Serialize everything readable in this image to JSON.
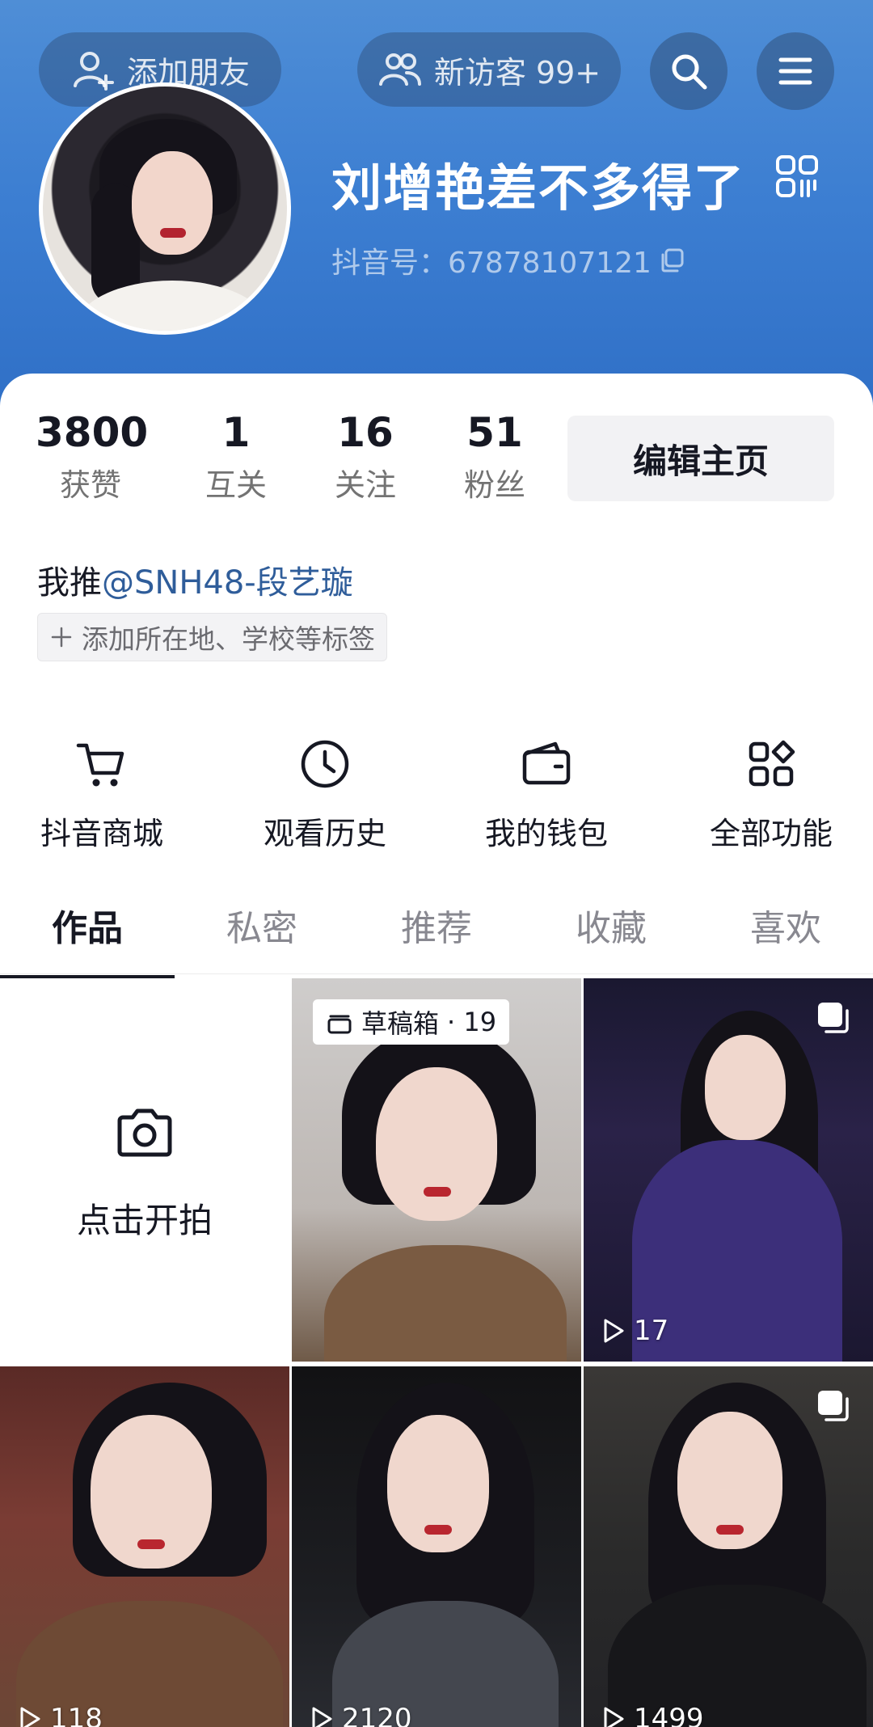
{
  "header": {
    "add_friend": "添加朋友",
    "visitors": "新访客 99+",
    "nickname": "刘增艳差不多得了",
    "douyin_id": "抖音号：67878107121"
  },
  "stats": [
    {
      "value": "3800",
      "label": "获赞"
    },
    {
      "value": "1",
      "label": "互关"
    },
    {
      "value": "16",
      "label": "关注"
    },
    {
      "value": "51",
      "label": "粉丝"
    }
  ],
  "edit_profile": "编辑主页",
  "bio": {
    "prefix": "我推",
    "mention": "@SNH48-段艺璇"
  },
  "add_tag": "添加所在地、学校等标签",
  "quick_actions": [
    {
      "label": "抖音商城",
      "icon": "cart-icon"
    },
    {
      "label": "观看历史",
      "icon": "clock-icon"
    },
    {
      "label": "我的钱包",
      "icon": "wallet-icon"
    },
    {
      "label": "全部功能",
      "icon": "grid-icon"
    }
  ],
  "tabs": [
    "作品",
    "私密",
    "推荐",
    "收藏",
    "喜欢"
  ],
  "grid": {
    "shoot_label": "点击开拍",
    "draft_label": "草稿箱",
    "draft_count": "· 19",
    "plays": [
      "17",
      "118",
      "2120",
      "1499"
    ]
  },
  "colors": {
    "header_blue": "#3d7fd2",
    "mention": "#2f5d9a",
    "text_primary": "#161823"
  }
}
